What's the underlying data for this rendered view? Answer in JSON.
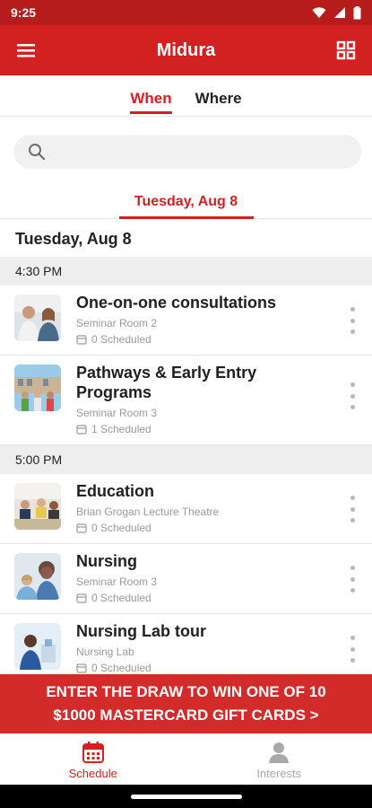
{
  "status_bar": {
    "time": "9:25",
    "icons": [
      "wifi-icon",
      "signal-icon",
      "battery-icon"
    ]
  },
  "app_bar": {
    "title": "Midura",
    "left_icon": "hamburger-menu-icon",
    "right_icon": "grid-icon"
  },
  "tabs": [
    {
      "label": "When",
      "active": true
    },
    {
      "label": "Where",
      "active": false
    }
  ],
  "search": {
    "placeholder": "",
    "value": "",
    "icon": "search-icon"
  },
  "date_tab": {
    "label": "Tuesday, Aug 8"
  },
  "day_header": "Tuesday, Aug 8",
  "groups": [
    {
      "time": "4:30 PM",
      "items": [
        {
          "title": "One-on-one consultations",
          "room": "Seminar Room 2",
          "scheduled": "0 Scheduled"
        },
        {
          "title": "Pathways & Early Entry Programs",
          "room": "Seminar Room 3",
          "scheduled": "1 Scheduled"
        }
      ]
    },
    {
      "time": "5:00 PM",
      "items": [
        {
          "title": "Education",
          "room": "Brian Grogan Lecture Theatre",
          "scheduled": "0 Scheduled"
        },
        {
          "title": "Nursing",
          "room": "Seminar Room 3",
          "scheduled": "0 Scheduled"
        },
        {
          "title": "Nursing Lab tour",
          "room": "Nursing Lab",
          "scheduled": "0 Scheduled"
        }
      ]
    }
  ],
  "promo": {
    "line1": "ENTER THE DRAW TO WIN ONE OF 10",
    "line2": "$1000 MASTERCARD GIFT CARDS >"
  },
  "bottom_nav": [
    {
      "label": "Schedule",
      "icon": "calendar-icon",
      "active": true
    },
    {
      "label": "Interests",
      "icon": "person-icon",
      "active": false
    }
  ],
  "colors": {
    "primary": "#d32020",
    "status_bar": "#b71c1c",
    "promo": "#d32a2a"
  }
}
